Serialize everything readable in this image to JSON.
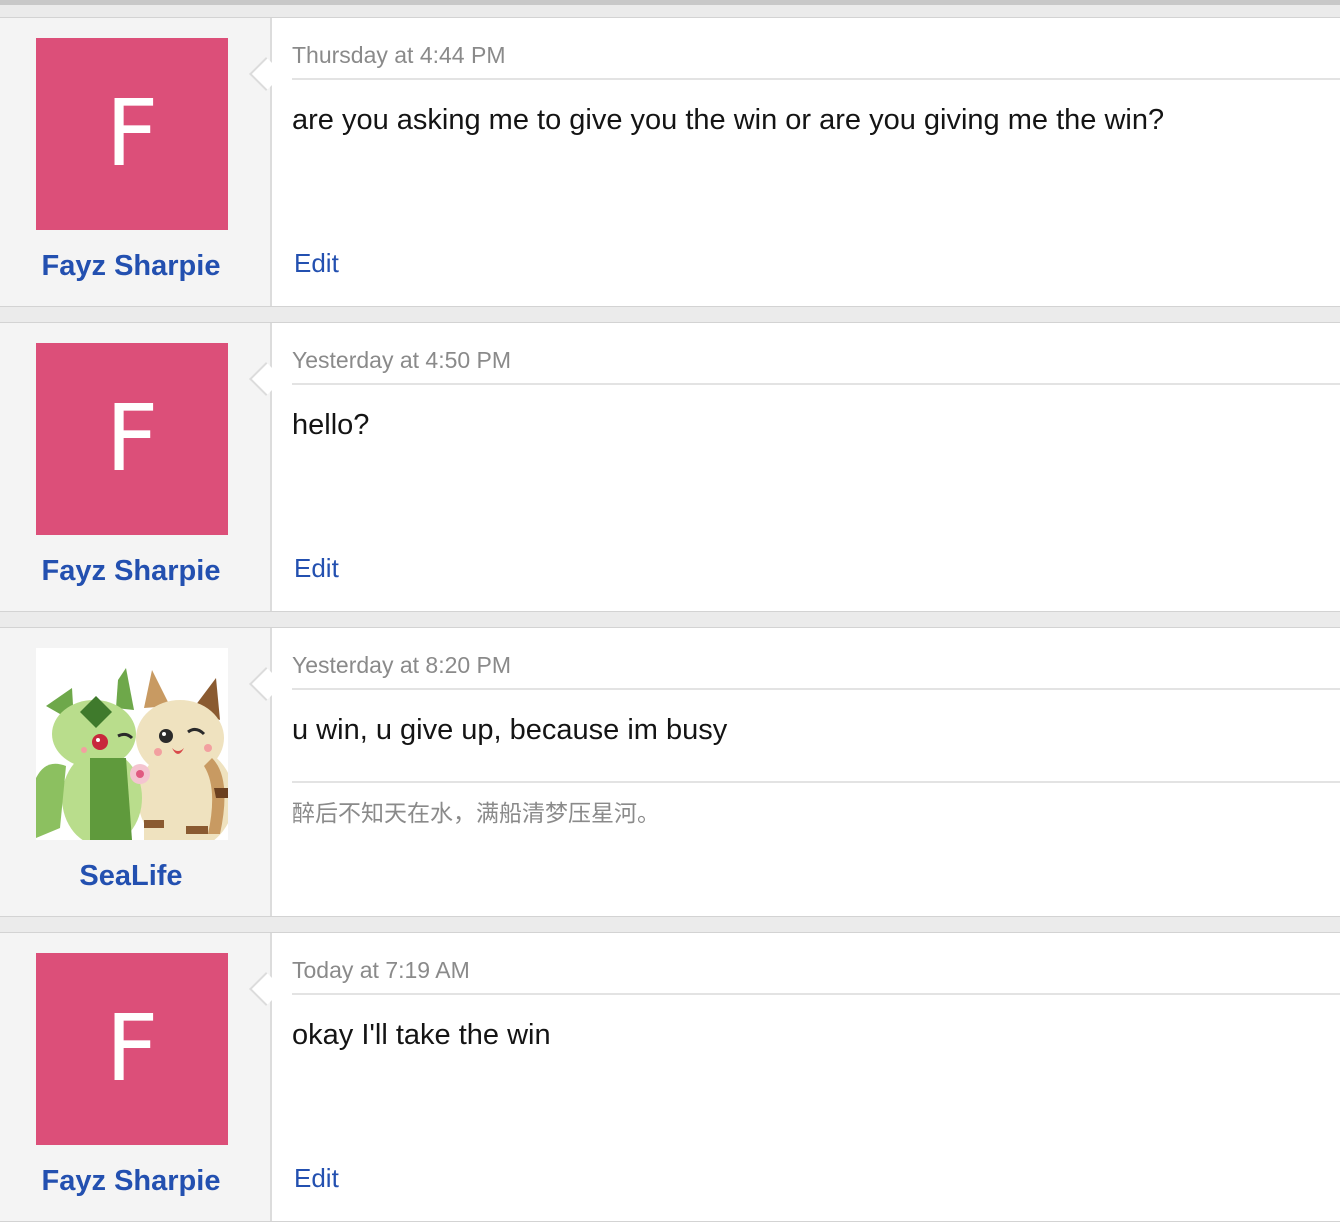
{
  "messages": [
    {
      "author": "Fayz Sharpie",
      "avatar_letter": "F",
      "avatar_color": "#dc4f79",
      "timestamp": "Thursday at 4:44 PM",
      "body": "are you asking me to give you the win or are you giving me the win?",
      "edit_label": "Edit"
    },
    {
      "author": "Fayz Sharpie",
      "avatar_letter": "F",
      "avatar_color": "#dc4f79",
      "timestamp": "Yesterday at 4:50 PM",
      "body": "hello?",
      "edit_label": "Edit"
    },
    {
      "author": "SeaLife",
      "avatar_type": "cartoon-cat-pair-image",
      "timestamp": "Yesterday at 8:20 PM",
      "body": "u win, u give up, because im busy",
      "signature": "醉后不知天在水，满船清梦压星河。"
    },
    {
      "author": "Fayz Sharpie",
      "avatar_letter": "F",
      "avatar_color": "#dc4f79",
      "timestamp": "Today at 7:19 AM",
      "body": "okay I'll take the win",
      "edit_label": "Edit"
    }
  ],
  "colors": {
    "username": "#2350b0",
    "link": "#2350b0",
    "timestamp": "#8a8a8a"
  }
}
